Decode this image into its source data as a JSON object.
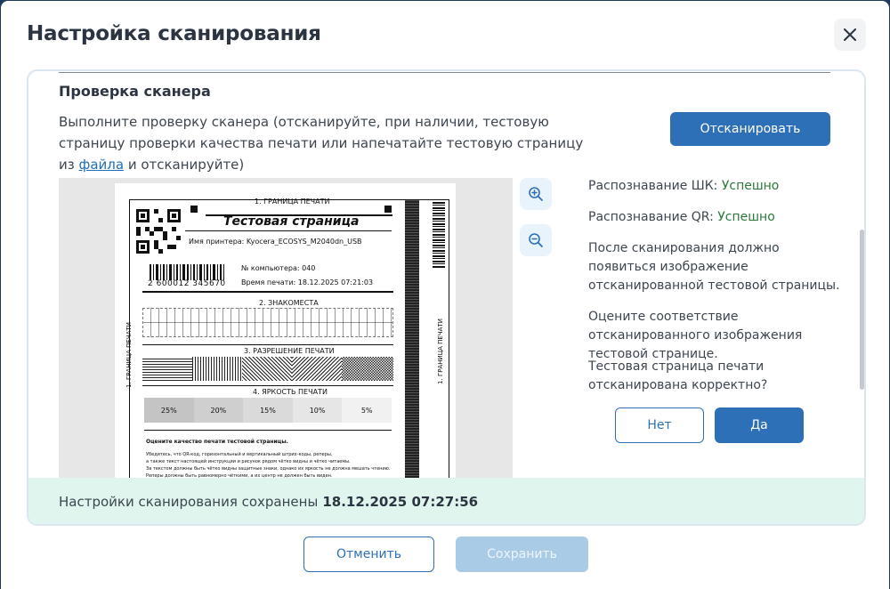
{
  "modal": {
    "title": "Настройка сканирования"
  },
  "scanner_check": {
    "title": "Проверка сканера",
    "instructions_before_link": "Выполните проверку сканера (отсканируйте, при наличии, тестовую страницу проверки качества печати или напечатайте тестовую страницу из ",
    "link_text": "файла",
    "instructions_after_link": " и отсканируйте)",
    "scan_button": "Отсканировать"
  },
  "test_page": {
    "print_border": "1. ГРАНИЦА ПЕЧАТИ",
    "heading": "Тестовая страница",
    "printer_name": "Имя принтера: Kyocera_ECOSYS_M2040dn_USB",
    "barcode_number": "2 600012 345670",
    "computer_number": "№ компьютера: 040",
    "print_time": "Время печати: 18.12.2025 07:21:03",
    "section_2": "2. ЗНАКОМЕСТА",
    "section_3": "3. РАЗРЕШЕНИЕ ПЕЧАТИ",
    "section_4": "4. ЯРКОСТЬ ПЕЧАТИ",
    "brightness_levels": [
      "25%",
      "20%",
      "15%",
      "10%",
      "5%"
    ],
    "side_label": "1. ГРАНИЦА ПЕЧАТИ",
    "quality_title": "Оцените качество печати тестовой страницы.",
    "quality_text_1": "Убедитесь, что QR-код, горизонтальный и вертикальный штрих-коды, реперы,",
    "quality_text_2": "а также текст настоящей инструкции и рисунок рядом чётко видны и чётко читаемы.",
    "quality_text_3": "За текстом должны быть чётко видны защитные знаки, однако их яркость не должна мешать чтению.",
    "quality_text_4": "Реперы должны быть равномерно чёткими, а их центр не должен быть виден."
  },
  "results": {
    "barcode_label": "Распознавание ШК:",
    "barcode_value": "Успешно",
    "qr_label": "Распознавание QR:",
    "qr_value": "Успешно",
    "info_1": "После сканирования должно появиться изображение отсканированной тестовой страницы.",
    "info_2": "Оцените соответствие отсканированного изображения тестовой странице.",
    "question": "Тестовая страница печати отсканирована корректно?",
    "no_button": "Нет",
    "yes_button": "Да"
  },
  "saved": {
    "text": "Настройки сканирования сохранены",
    "timestamp": "18.12.2025 07:27:56"
  },
  "footer": {
    "cancel": "Отменить",
    "save": "Сохранить"
  },
  "icons": {
    "close": "close-icon",
    "zoom_in": "zoom-in-icon",
    "zoom_out": "zoom-out-icon"
  },
  "colors": {
    "primary": "#2e70b7",
    "success": "#2a7a3a",
    "saved_bar": "#dff5ee",
    "save_disabled": "#a9cbe6"
  }
}
